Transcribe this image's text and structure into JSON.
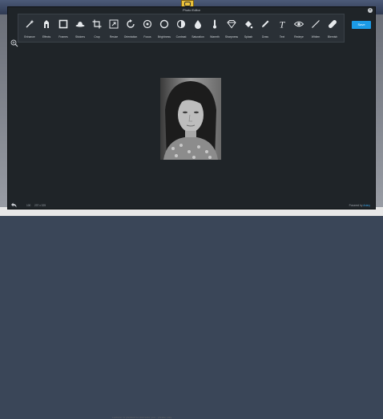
{
  "editor": {
    "title": "Photo Editor",
    "close_glyph": "×",
    "save_label": "Save"
  },
  "toolbar": {
    "tools": [
      {
        "label": "Enhance",
        "icon": "magic-wand-icon"
      },
      {
        "label": "Effects",
        "icon": "effects-icon"
      },
      {
        "label": "Frames",
        "icon": "frame-icon"
      },
      {
        "label": "Stickers",
        "icon": "sticker-icon"
      },
      {
        "label": "Crop",
        "icon": "crop-icon"
      },
      {
        "label": "Resize",
        "icon": "resize-icon"
      },
      {
        "label": "Orientation",
        "icon": "rotate-icon"
      },
      {
        "label": "Focus",
        "icon": "focus-icon"
      },
      {
        "label": "Brightness",
        "icon": "brightness-icon"
      },
      {
        "label": "Contrast",
        "icon": "contrast-icon"
      },
      {
        "label": "Saturation",
        "icon": "saturation-icon"
      },
      {
        "label": "Warmth",
        "icon": "thermometer-icon"
      },
      {
        "label": "Sharpness",
        "icon": "diamond-icon"
      },
      {
        "label": "Splash",
        "icon": "splash-icon"
      },
      {
        "label": "Draw",
        "icon": "pencil-icon"
      },
      {
        "label": "Text",
        "icon": "text-icon"
      },
      {
        "label": "Redeye",
        "icon": "eye-icon"
      },
      {
        "label": "Whiten",
        "icon": "wand-icon"
      },
      {
        "label": "Blemish",
        "icon": "bandage-icon"
      }
    ]
  },
  "footer": {
    "zoom_level": "100",
    "dimensions": "237 x 325",
    "powered_prefix": "Powered by",
    "powered_brand": "Aviary"
  },
  "background": {
    "bottom_text": "Lecturer is pleased to welcome you · please stay"
  },
  "colors": {
    "accent": "#1c9be6",
    "panel": "#1f2428",
    "toolbar": "#2a3036"
  }
}
